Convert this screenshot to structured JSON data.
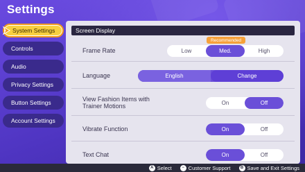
{
  "page": {
    "title": "Settings"
  },
  "sidebar": {
    "items": [
      {
        "label": "System Settings",
        "active": true
      },
      {
        "label": "Controls"
      },
      {
        "label": "Audio"
      },
      {
        "label": "Privacy Settings"
      },
      {
        "label": "Button Settings"
      },
      {
        "label": "Account Settings"
      }
    ]
  },
  "panel": {
    "header": "Screen Display",
    "frame_rate": {
      "label": "Frame Rate",
      "badge": "Recommended",
      "options": [
        "Low",
        "Med.",
        "High"
      ],
      "selected": "Med."
    },
    "language": {
      "label": "Language",
      "value": "English",
      "change_label": "Change"
    },
    "fashion": {
      "label_line1": "View Fashion Items with",
      "label_line2": "Trainer Motions",
      "options": [
        "On",
        "Off"
      ],
      "selected": "Off"
    },
    "vibrate": {
      "label": "Vibrate Function",
      "options": [
        "On",
        "Off"
      ],
      "selected": "On"
    },
    "text_chat": {
      "label": "Text Chat",
      "options": [
        "On",
        "Off"
      ],
      "selected": "On"
    }
  },
  "footer": {
    "select": {
      "glyph": "A",
      "label": "Select"
    },
    "support": {
      "glyph": "−",
      "label": "Customer Support"
    },
    "save": {
      "glyph": "B",
      "label": "Save and Exit Settings"
    }
  },
  "colors": {
    "background": "#5a3fcf",
    "active_tab": "#f8d040",
    "toggle_on": "#6a4fd8",
    "badge": "#f6a13a"
  }
}
